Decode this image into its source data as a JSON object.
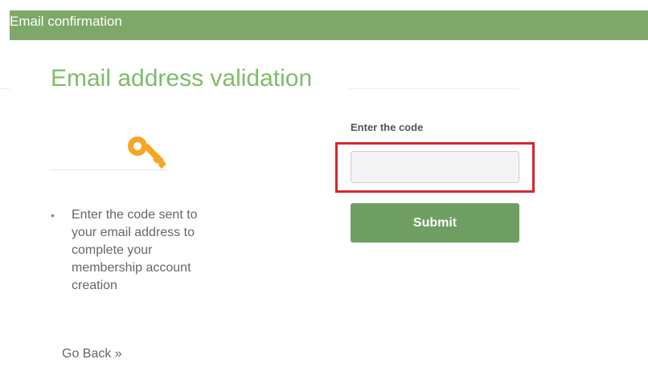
{
  "header": {
    "title": "Email confirmation",
    "color": "#7ea86a"
  },
  "main": {
    "title": "Email address validation",
    "title_color": "#7cbd6a",
    "icon": "key-icon",
    "icon_color": "#f5a623",
    "instructions": [
      "Enter the code sent to your email address to complete your membership account creation"
    ],
    "go_back_label": "Go Back »"
  },
  "form": {
    "code_label": "Enter the code",
    "code_value": "",
    "code_placeholder": "",
    "submit_label": "Submit",
    "submit_color": "#6f9e62",
    "highlight_color": "#d7262e"
  }
}
